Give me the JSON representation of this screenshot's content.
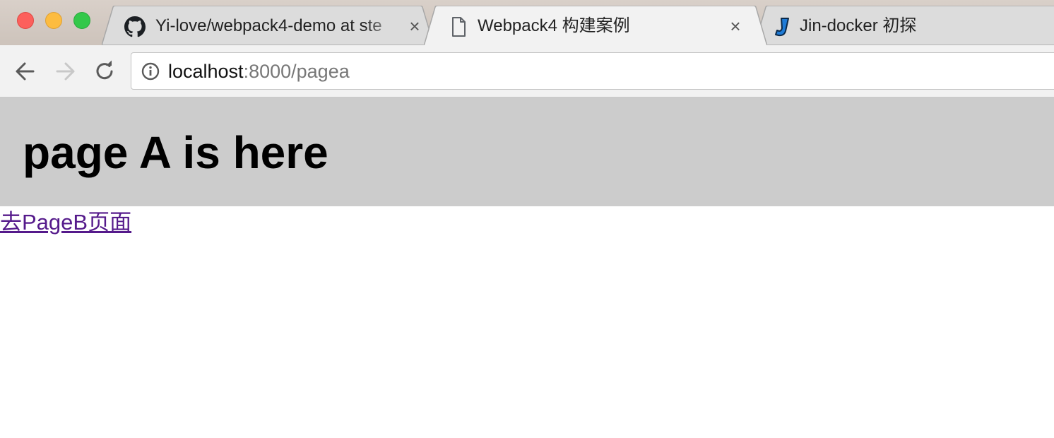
{
  "window": {
    "controls": [
      "close",
      "minimize",
      "maximize"
    ]
  },
  "tabs": [
    {
      "title": "Yi-love/webpack4-demo at ste",
      "icon": "github-icon",
      "active": false,
      "close_label": "×"
    },
    {
      "title": "Webpack4 构建案例",
      "icon": "document-icon",
      "active": true,
      "close_label": "×"
    },
    {
      "title": "Jin-docker 初探",
      "icon": "jin-logo-icon",
      "active": false
    }
  ],
  "toolbar": {
    "back_icon": "arrow-left-icon",
    "forward_icon": "arrow-right-icon",
    "reload_icon": "reload-icon",
    "address": {
      "info_icon": "info-icon",
      "host": "localhost",
      "rest": ":8000/pagea"
    }
  },
  "page": {
    "heading": "page A is here",
    "link_label": "去PageB页面"
  },
  "colors": {
    "header_bg": "#cccccc",
    "visited_link": "#551a8b",
    "active_tab_bg": "#f2f2f2",
    "inactive_tab_bg": "#dcdcdc"
  }
}
